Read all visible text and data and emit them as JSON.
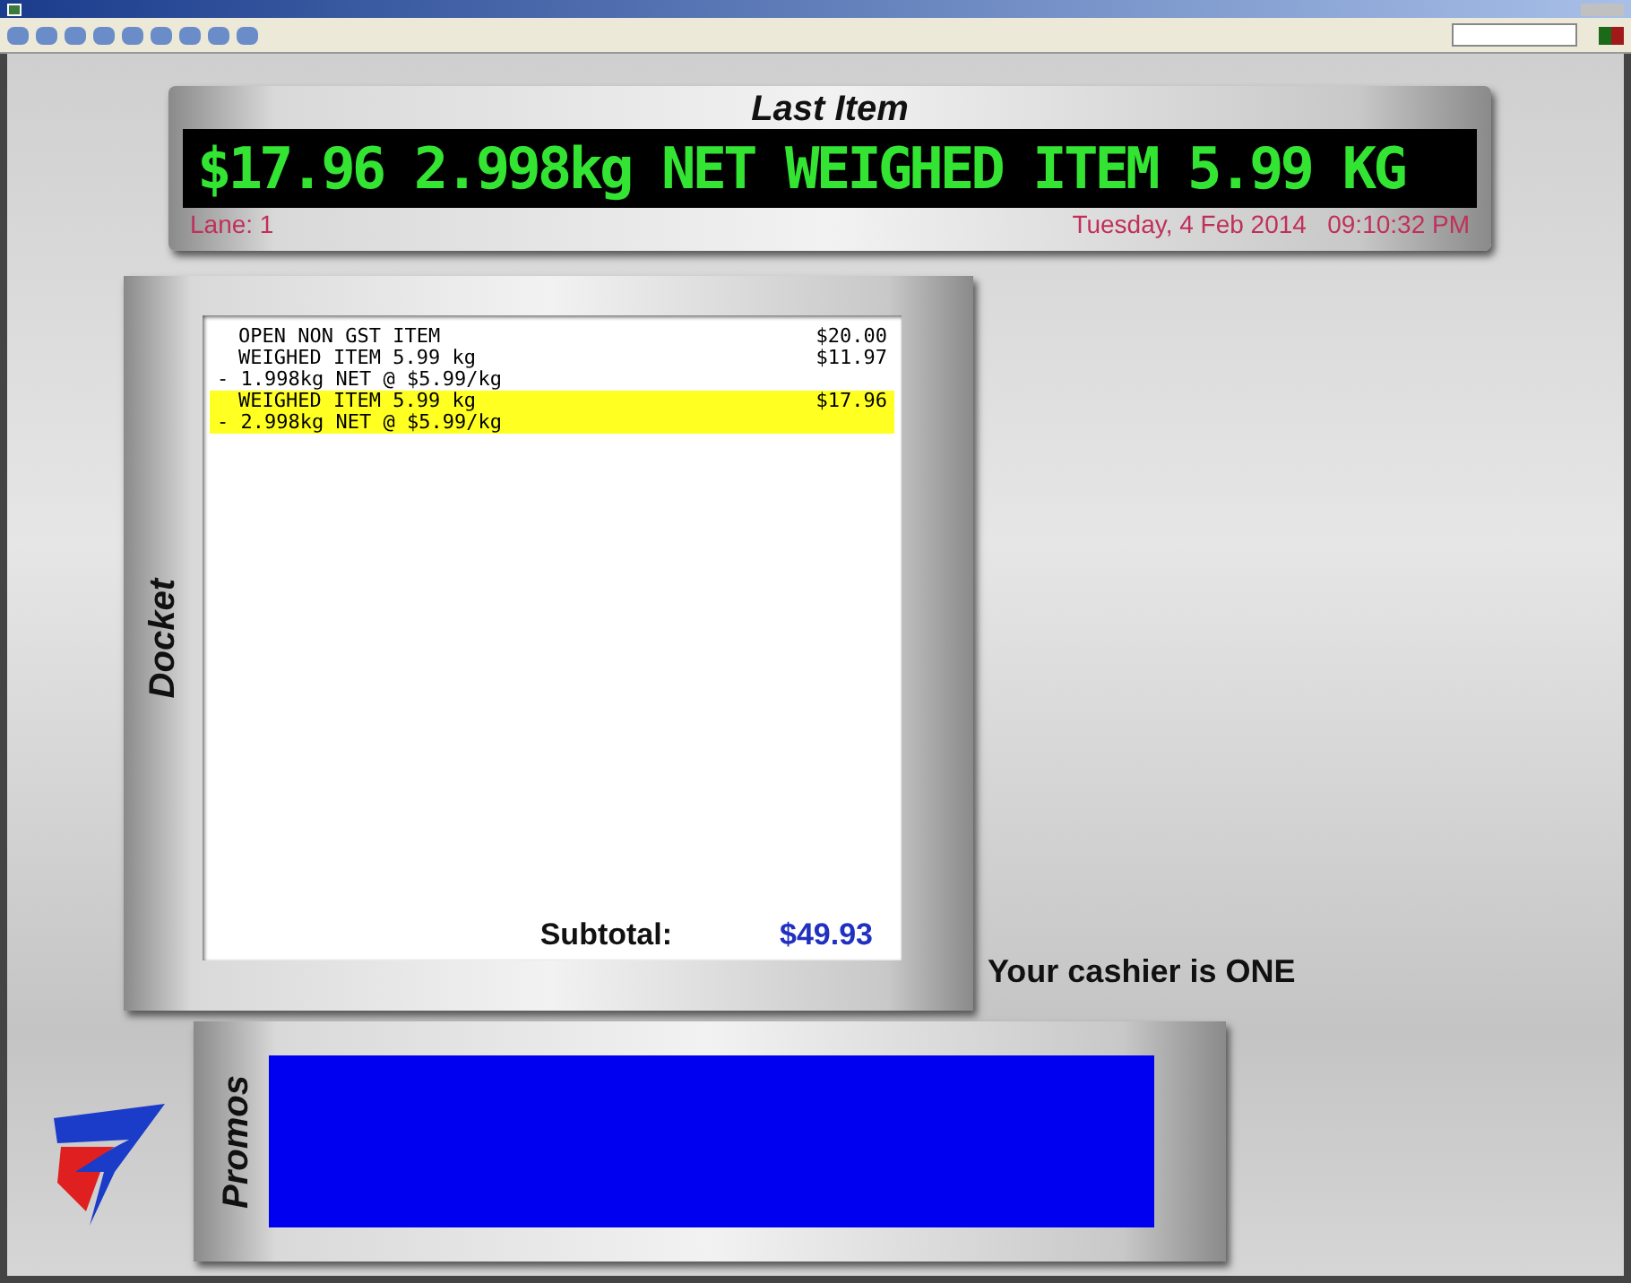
{
  "last_item": {
    "title": "Last Item",
    "display": "$17.96 2.998kg NET WEIGHED ITEM 5.99 KG",
    "lane": "Lane: 1",
    "datetime": "Tuesday, 4 Feb 2014   09:10:32 PM"
  },
  "docket": {
    "title": "Docket",
    "items": [
      {
        "lines": [
          "OPEN NON GST ITEM"
        ],
        "price": "$20.00",
        "selected": false
      },
      {
        "lines": [
          "WEIGHED ITEM 5.99 kg",
          "- 1.998kg NET @ $5.99/kg"
        ],
        "price": "$11.97",
        "selected": false
      },
      {
        "lines": [
          "WEIGHED ITEM 5.99 kg",
          "- 2.998kg NET @ $5.99/kg"
        ],
        "price": "$17.96",
        "selected": true
      }
    ],
    "subtotal_label": "Subtotal:",
    "subtotal": "$49.93"
  },
  "cashier_message": "Your cashier is ONE",
  "promos": {
    "title": "Promos"
  }
}
